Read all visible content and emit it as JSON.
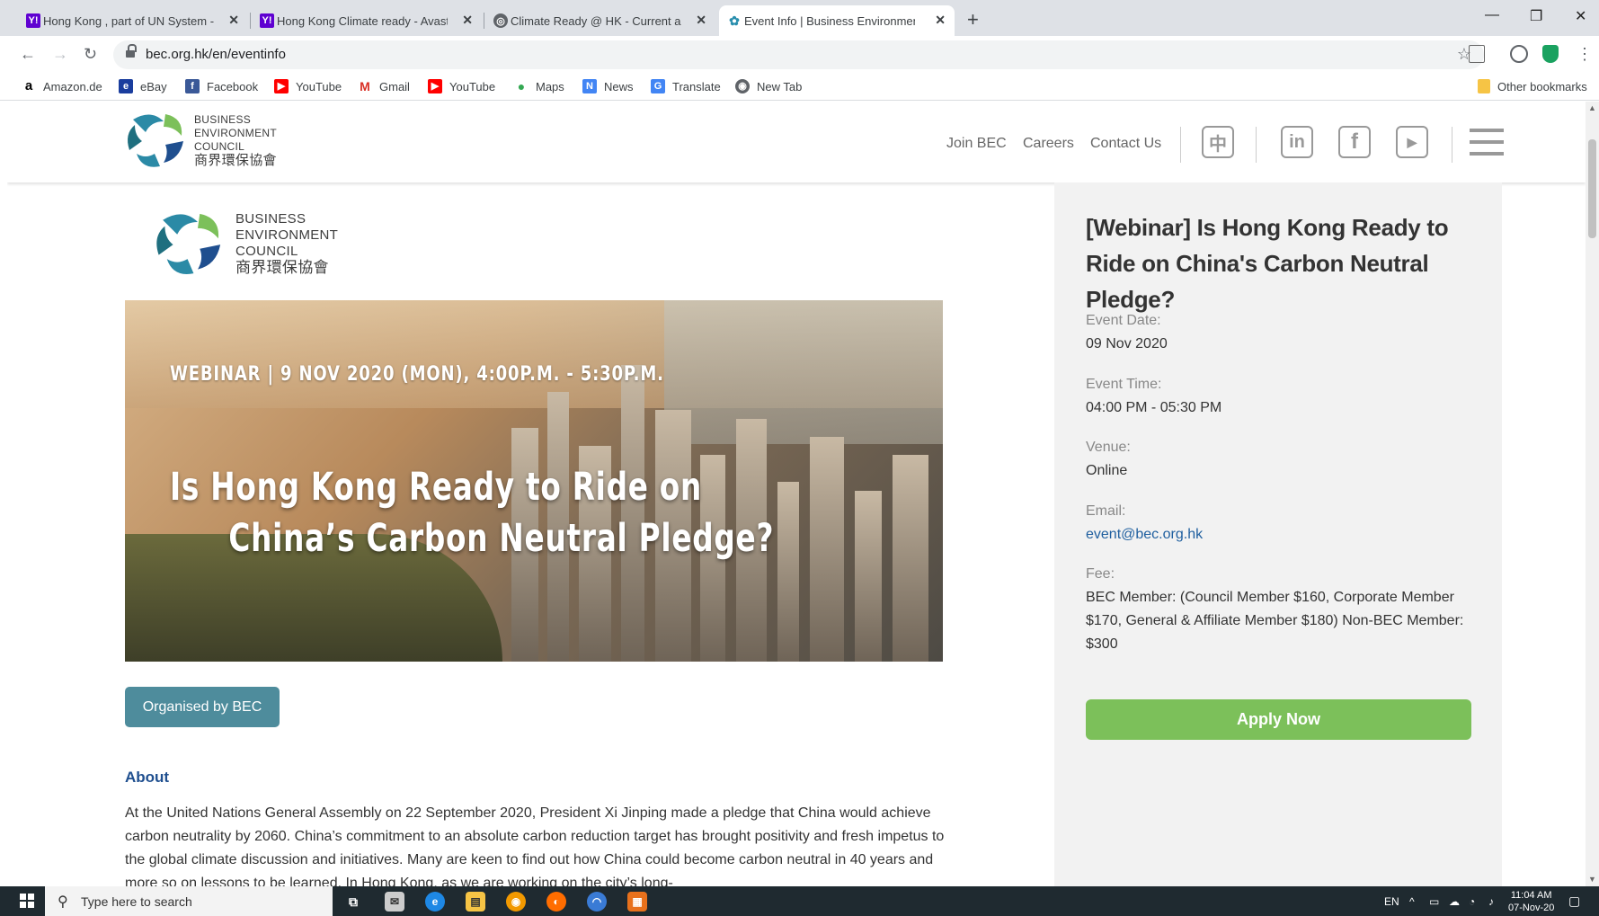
{
  "browser": {
    "tabs": [
      {
        "title": "Hong Kong , part of UN System -",
        "favicon": "yahoo-icon",
        "active": false
      },
      {
        "title": "Hong Kong Climate ready - Avast",
        "favicon": "yahoo-icon",
        "active": false
      },
      {
        "title": "Climate Ready @ HK - Current an",
        "favicon": "globe-icon",
        "active": false
      },
      {
        "title": "Event Info | Business Environmen",
        "favicon": "bec-icon",
        "active": true
      }
    ],
    "url": "bec.org.hk/en/eventinfo",
    "bookmarks": [
      {
        "label": "Amazon.de",
        "icon": "amazon-icon",
        "color": "#000000"
      },
      {
        "label": "eBay",
        "icon": "ebay-icon",
        "color": "#1a3d9e"
      },
      {
        "label": "Facebook",
        "icon": "facebook-icon",
        "color": "#3b5998"
      },
      {
        "label": "YouTube",
        "icon": "youtube-icon",
        "color": "#ff0000"
      },
      {
        "label": "Gmail",
        "icon": "gmail-icon",
        "color": "#d93025"
      },
      {
        "label": "YouTube",
        "icon": "youtube-icon",
        "color": "#ff0000"
      },
      {
        "label": "Maps",
        "icon": "maps-icon",
        "color": "#34a853"
      },
      {
        "label": "News",
        "icon": "news-icon",
        "color": "#4285f4"
      },
      {
        "label": "Translate",
        "icon": "translate-icon",
        "color": "#4285f4"
      },
      {
        "label": "New Tab",
        "icon": "chrome-icon",
        "color": "#5f6368"
      }
    ],
    "other_bookmarks": "Other bookmarks"
  },
  "header": {
    "logo": {
      "line1": "BUSINESS",
      "line2": "ENVIRONMENT",
      "line3": "COUNCIL",
      "zh": "商界環保協會"
    },
    "nav": [
      {
        "label": "Join BEC"
      },
      {
        "label": "Careers"
      },
      {
        "label": "Contact Us"
      }
    ],
    "lang_icon": "中",
    "social": [
      "linkedin-icon",
      "facebook-icon",
      "youtube-icon"
    ]
  },
  "main": {
    "logo": {
      "line1": "BUSINESS",
      "line2": "ENVIRONMENT",
      "line3": "COUNCIL",
      "zh": "商界環保協會"
    },
    "hero": {
      "subtitle": "WEBINAR | 9 NOV 2020 (MON), 4:00P.M. - 5:30P.M.",
      "title_line1": "Is Hong Kong Ready to Ride on",
      "title_line2": "China’s Carbon Neutral Pledge?"
    },
    "organised_label": "Organised by BEC",
    "about_heading": "About",
    "about_text": "At the United Nations General Assembly on 22 September 2020, President Xi Jinping made a pledge that China would achieve carbon neutrality by 2060. China’s commitment to an absolute carbon reduction target has brought positivity and fresh impetus to the global climate discussion and initiatives. Many are keen to find out how China could become carbon neutral in 40 years and more so on lessons to be learned. In Hong Kong, as we are working on the city’s long-"
  },
  "sidebar": {
    "title": "[Webinar] Is Hong Kong Ready to Ride on China's Carbon Neutral Pledge?",
    "date_label": "Event Date:",
    "date_value": "09 Nov 2020",
    "time_label": "Event Time:",
    "time_value": "04:00 PM - 05:30 PM",
    "venue_label": "Venue:",
    "venue_value": "Online",
    "email_label": "Email:",
    "email_value": "event@bec.org.hk",
    "fee_label": "Fee:",
    "fee_value": "BEC Member: (Council Member $160, Corporate Member $170, General & Affiliate Member $180) Non-BEC Member: $300",
    "apply_label": "Apply Now"
  },
  "taskbar": {
    "search_placeholder": "Type here to search",
    "lang": "EN",
    "time": "11:04 AM",
    "date": "07-Nov-20"
  },
  "colors": {
    "accent_teal": "#4e8c9c",
    "apply_green": "#7cc05a",
    "heading_blue": "#1f4f8f",
    "link_blue": "#1f5f9f"
  }
}
